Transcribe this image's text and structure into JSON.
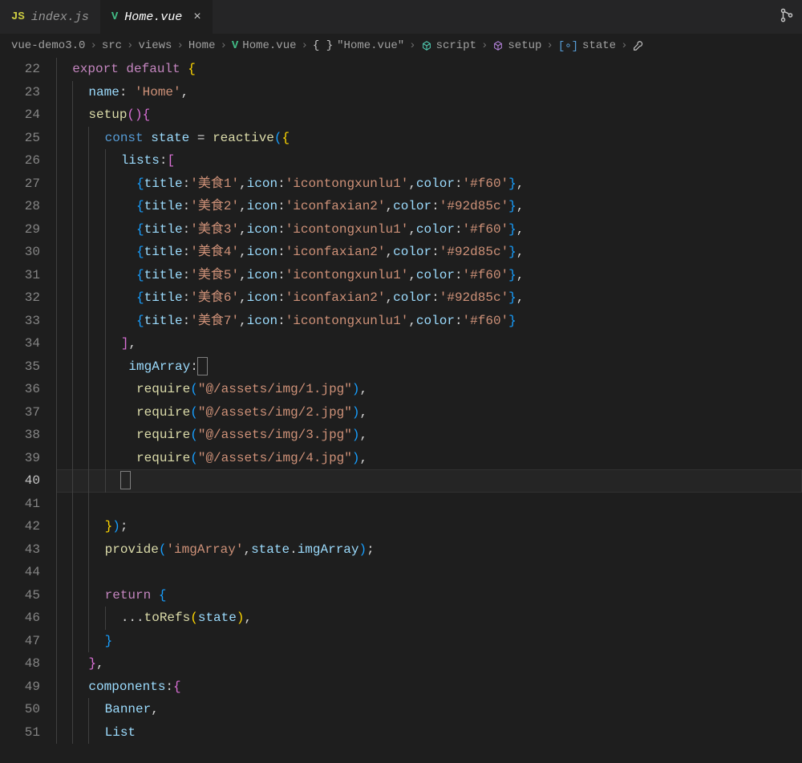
{
  "tabs": [
    {
      "icon": "JS",
      "iconColor": "#cbcb41",
      "label": "index.js",
      "active": false
    },
    {
      "icon": "V",
      "iconColor": "#41b883",
      "label": "Home.vue",
      "active": true
    }
  ],
  "breadcrumbs": [
    {
      "label": "vue-demo3.0"
    },
    {
      "label": "src"
    },
    {
      "label": "views"
    },
    {
      "label": "Home"
    },
    {
      "icon": "vue",
      "label": "Home.vue"
    },
    {
      "icon": "braces",
      "label": "\"Home.vue\""
    },
    {
      "icon": "cube",
      "label": "script"
    },
    {
      "icon": "cube",
      "label": "setup"
    },
    {
      "icon": "brackets",
      "label": "state"
    },
    {
      "icon": "wrench",
      "label": ""
    }
  ],
  "gutter": {
    "start": 22,
    "end": 51,
    "highlight": 40
  },
  "code": {
    "l22": {
      "export": "export",
      "default": "default"
    },
    "l23": {
      "prop": "name",
      "val": "'Home'"
    },
    "l24": {
      "fn": "setup"
    },
    "l25": {
      "const": "const",
      "var": "state",
      "fn": "reactive"
    },
    "l26": {
      "prop": "lists"
    },
    "rows": [
      {
        "t": "'美食1'",
        "i": "'icontongxunlu1'",
        "c": "'#f60'"
      },
      {
        "t": "'美食2'",
        "i": "'iconfaxian2'",
        "c": "'#92d85c'"
      },
      {
        "t": "'美食3'",
        "i": "'icontongxunlu1'",
        "c": "'#f60'"
      },
      {
        "t": "'美食4'",
        "i": "'iconfaxian2'",
        "c": "'#92d85c'"
      },
      {
        "t": "'美食5'",
        "i": "'icontongxunlu1'",
        "c": "'#f60'"
      },
      {
        "t": "'美食6'",
        "i": "'iconfaxian2'",
        "c": "'#92d85c'"
      },
      {
        "t": "'美食7'",
        "i": "'icontongxunlu1'",
        "c": "'#f60'"
      }
    ],
    "propTitle": "title",
    "propIcon": "icon",
    "propColor": "color",
    "l35": {
      "prop": "imgArray"
    },
    "req": "require",
    "imgs": [
      "\"@/assets/img/1.jpg\"",
      "\"@/assets/img/2.jpg\"",
      "\"@/assets/img/3.jpg\"",
      "\"@/assets/img/4.jpg\""
    ],
    "l43": {
      "fn": "provide",
      "arg1": "'imgArray'",
      "obj": "state",
      "prop": "imgArray"
    },
    "l45": {
      "return": "return"
    },
    "l46": {
      "fn": "toRefs",
      "arg": "state"
    },
    "l49": {
      "prop": "components"
    },
    "l50": {
      "v": "Banner"
    },
    "l51": {
      "v": "List"
    }
  }
}
